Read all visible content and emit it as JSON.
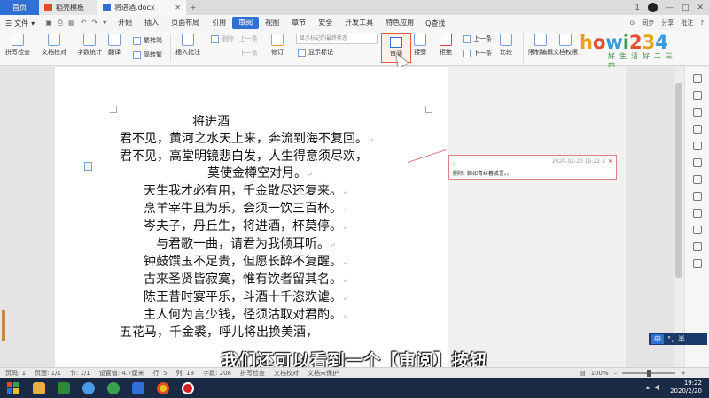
{
  "tabs": {
    "home": "首页",
    "template": "稻壳模板",
    "document": "将进酒.docx",
    "add": "+"
  },
  "window": {
    "badge": "1",
    "controls": [
      "—",
      "□",
      "✕"
    ]
  },
  "menu": {
    "file": "文件",
    "items": [
      "开始",
      "插入",
      "页面布局",
      "引用",
      "审阅",
      "视图",
      "章节",
      "安全",
      "开发工具",
      "特色应用"
    ],
    "active": "审阅",
    "search": "Q查找",
    "right": [
      "⊙",
      "同步",
      "分享",
      "批注",
      "?"
    ]
  },
  "ribbon": {
    "spell_check": "拼写检查",
    "doc_proof": "文档校对",
    "word_count": "字数统计",
    "translate": "翻译",
    "to_traditional": "繁转简",
    "to_simplified": "简转繁",
    "insert_comment": "插入批注",
    "delete_comment": "删除",
    "prev_comment": "上一条",
    "next_comment": "下一条",
    "track_changes": "修订",
    "display_state": "显示标记的最终状态",
    "show_markup": "显示标记",
    "review_pane": "审阅",
    "accept": "接受",
    "reject": "拒绝",
    "prev_change": "上一条",
    "next_change": "下一条",
    "compare": "比较",
    "restrict_edit": "限制编辑",
    "doc_rights": "文档权限"
  },
  "logo": {
    "brand": "howi234",
    "tagline": "好生活好二三四"
  },
  "document": {
    "lines": [
      "将进酒",
      "君不见，黄河之水天上来，奔流到海不复回。",
      "君不见，高堂明镜悲白发，人生得意须尽欢，",
      "莫使金樽空对月。",
      "天生我才必有用，千金散尽还复来。",
      "烹羊宰牛且为乐，会须一饮三百杯。",
      "岑夫子，丹丘生，将进酒，杯莫停。",
      "与君歌一曲，请君为我倾耳听。",
      "钟鼓馔玉不足贵，但愿长醉不复醒。",
      "古来圣贤皆寂寞，惟有饮者留其名。",
      "陈王昔时宴平乐，斗酒十千恣欢谑。",
      "主人何为言少钱，径须沽取对君酌。",
      "五花马，千金裘，呼儿将出换美酒，"
    ],
    "paragraph_mark": "↵"
  },
  "comment": {
    "author": "、",
    "timestamp": "2020-02-20 19:22",
    "text": "删除: 朝如青丝暮成雪。。",
    "accept": "✓",
    "reject": "✕"
  },
  "subtitle": "我们还可以看到一个【审阅】按钮",
  "ime": {
    "mode": "中",
    "extra": "°，半"
  },
  "status": {
    "page": "页码: 1",
    "pages": "页面: 1/1",
    "section": "节: 1/1",
    "setting": "设置值: 4.7厘米",
    "row": "行: 5",
    "col": "列: 13",
    "words": "字数: 208",
    "spell": "拼写检查",
    "proof": "文档校对",
    "unprotected": "文档未保护",
    "zoom": "100%"
  },
  "taskbar": {
    "time": "19:22",
    "date": "2020/2/20",
    "apps": [
      "explorer",
      "excel",
      "baidu-netdisk",
      "ie",
      "wps-writer",
      "chrome",
      "recorder"
    ]
  },
  "colors": {
    "accent": "#2f6fd6",
    "review_highlight": "#e25c40",
    "comment_border": "#e08080"
  }
}
